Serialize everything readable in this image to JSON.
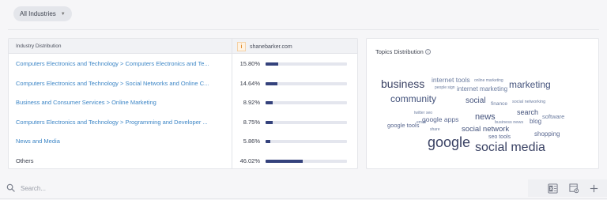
{
  "filter": {
    "label": "All Industries",
    "icon": "chevron-down-icon"
  },
  "industry_table": {
    "column_header": "Industry Distribution",
    "site": {
      "badge": "i",
      "name": "shanebarker.com"
    },
    "rows": [
      {
        "category": "Computers Electronics and Technology > Computers Electronics and Te...",
        "percent": "15.80%",
        "share": 0.158,
        "link": true
      },
      {
        "category": "Computers Electronics and Technology > Social Networks and Online C...",
        "percent": "14.64%",
        "share": 0.1464,
        "link": true
      },
      {
        "category": "Business and Consumer Services > Online Marketing",
        "percent": "8.92%",
        "share": 0.0892,
        "link": true
      },
      {
        "category": "Computers Electronics and Technology > Programming and Developer ...",
        "percent": "8.75%",
        "share": 0.0875,
        "link": true
      },
      {
        "category": "News and Media",
        "percent": "5.86%",
        "share": 0.0586,
        "link": true
      },
      {
        "category": "Others",
        "percent": "46.02%",
        "share": 0.4602,
        "link": false
      }
    ],
    "bar_color": "#34427c"
  },
  "topics": {
    "title": "Topics Distribution",
    "icon": "info-icon",
    "words": [
      "business",
      "internet tools",
      "online marketing",
      "marketing",
      "people sign",
      "internet marketing",
      "community",
      "social",
      "finance",
      "social networking",
      "news",
      "search",
      "google apps",
      "blog",
      "software",
      "google tools",
      "social network",
      "seo tools",
      "shopping",
      "google",
      "social media",
      "business news",
      "media",
      "share",
      "twitter",
      "seo",
      "email"
    ]
  },
  "search": {
    "placeholder": "Search...",
    "icon": "search-icon"
  },
  "toolbar": {
    "icons": [
      "excel-export-icon",
      "column-settings-icon",
      "add-icon"
    ]
  }
}
